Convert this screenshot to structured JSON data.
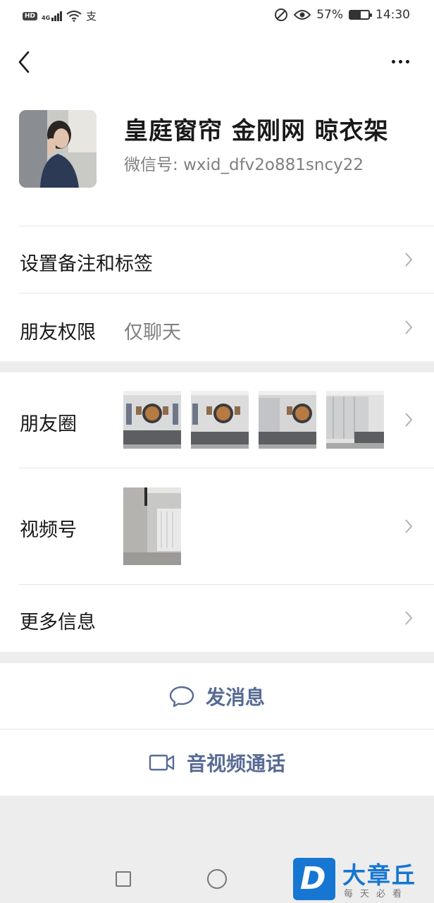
{
  "status_bar": {
    "network": "HD",
    "signal": "4G",
    "alipay_icon": "支",
    "battery_percent": "57%",
    "battery_level": 0.57,
    "time": "14:30"
  },
  "nav": {
    "back_icon": "chevron-left-icon",
    "more_icon": "more-horizontal-icon"
  },
  "profile": {
    "name": "皇庭窗帘 金刚网 晾衣架",
    "wechat_id_label": "微信号:",
    "wechat_id": "wxid_dfv2o881sncy22"
  },
  "cells": {
    "remark_tags": {
      "label": "设置备注和标签"
    },
    "permissions": {
      "label": "朋友权限",
      "value": "仅聊天"
    },
    "moments": {
      "label": "朋友圈"
    },
    "channels": {
      "label": "视频号"
    },
    "more_info": {
      "label": "更多信息"
    }
  },
  "actions": {
    "message": {
      "label": "发消息",
      "icon": "chat-bubble-icon"
    },
    "call": {
      "label": "音视频通话",
      "icon": "video-camera-icon"
    }
  },
  "watermark": {
    "logo_letter": "D",
    "name": "大章丘",
    "slogan": "每天必看"
  },
  "colors": {
    "link_blue": "#576b95",
    "secondary_text": "#7f7f7f",
    "background": "#ededed",
    "watermark_blue": "#1676d2"
  }
}
